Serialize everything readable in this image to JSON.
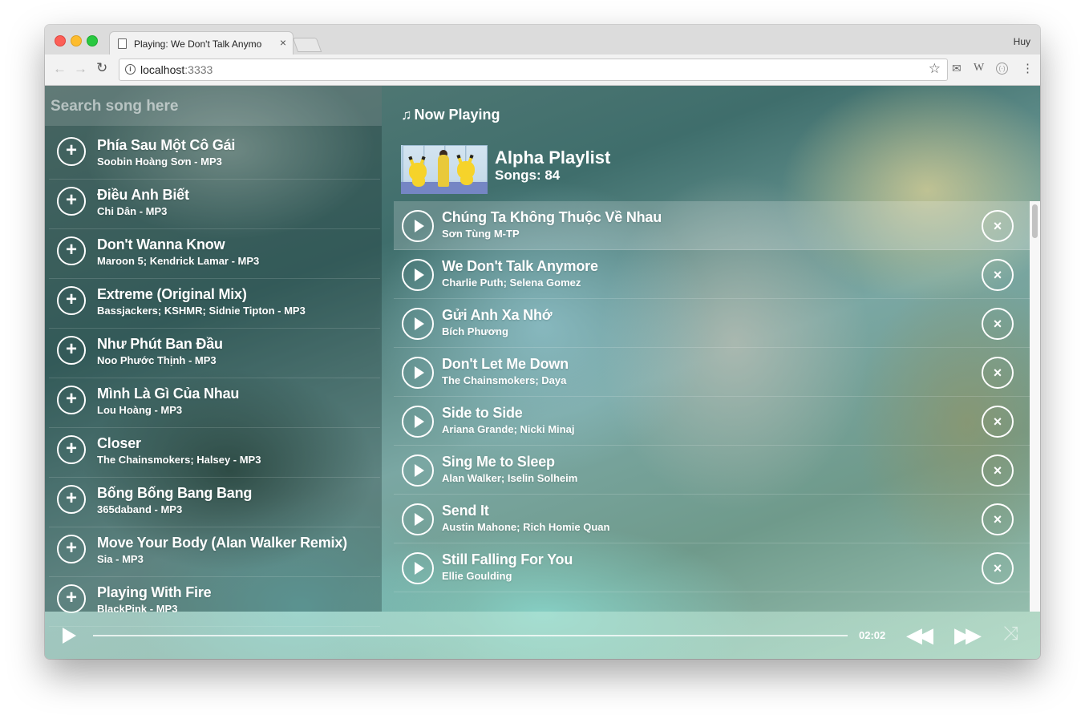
{
  "browser": {
    "tab_title": "Playing: We Don't Talk Anymore",
    "tab_close": "×",
    "profile_name": "Huy",
    "url_host": "localhost",
    "url_port": ":3333",
    "icons": {
      "back": "←",
      "forward": "→",
      "reload": "↻",
      "info": "i",
      "star": "☆",
      "ext1": "✉",
      "ext2": "W",
      "ext3": "(·)",
      "menu": "⋮"
    }
  },
  "search": {
    "placeholder": "Search song here"
  },
  "library": [
    {
      "title": "Phía Sau Một Cô Gái",
      "subtitle": "Soobin Hoàng Sơn - MP3"
    },
    {
      "title": "Điều Anh Biết",
      "subtitle": "Chi Dân - MP3"
    },
    {
      "title": "Don't Wanna Know",
      "subtitle": "Maroon 5; Kendrick Lamar - MP3"
    },
    {
      "title": "Extreme (Original Mix)",
      "subtitle": "Bassjackers; KSHMR; Sidnie Tipton - MP3"
    },
    {
      "title": "Như Phút Ban Đầu",
      "subtitle": "Noo Phước Thịnh - MP3"
    },
    {
      "title": "Mình Là Gì Của Nhau",
      "subtitle": "Lou Hoàng - MP3"
    },
    {
      "title": "Closer",
      "subtitle": "The Chainsmokers; Halsey - MP3"
    },
    {
      "title": "Bống Bống Bang Bang",
      "subtitle": "365daband - MP3"
    },
    {
      "title": "Move Your Body (Alan Walker Remix)",
      "subtitle": "Sia - MP3"
    },
    {
      "title": "Playing With Fire",
      "subtitle": "BlackPink - MP3"
    }
  ],
  "now_playing": {
    "heading": "Now Playing",
    "note_icon": "♫",
    "playlist_name": "Alpha Playlist",
    "song_count": "Songs: 84"
  },
  "queue": [
    {
      "title": "Chúng Ta Không Thuộc Về Nhau",
      "artist": "Sơn Tùng M-TP",
      "active": true
    },
    {
      "title": "We Don't Talk Anymore",
      "artist": "Charlie Puth; Selena Gomez"
    },
    {
      "title": "Gửi Anh Xa Nhớ",
      "artist": "Bích Phương"
    },
    {
      "title": "Don't Let Me Down",
      "artist": "The Chainsmokers; Daya"
    },
    {
      "title": "Side to Side",
      "artist": "Ariana Grande; Nicki Minaj"
    },
    {
      "title": "Sing Me to Sleep",
      "artist": "Alan Walker; Iselin Solheim"
    },
    {
      "title": "Send It",
      "artist": "Austin Mahone; Rich Homie Quan"
    },
    {
      "title": "Still Falling For You",
      "artist": "Ellie Goulding"
    }
  ],
  "player": {
    "time": "02:02",
    "progress": 0.0,
    "icons": {
      "play": "play-icon",
      "rewind": "◀◀",
      "forward": "▶▶",
      "shuffle": "⤨"
    }
  },
  "icons": {
    "add": "+",
    "remove": "×"
  }
}
